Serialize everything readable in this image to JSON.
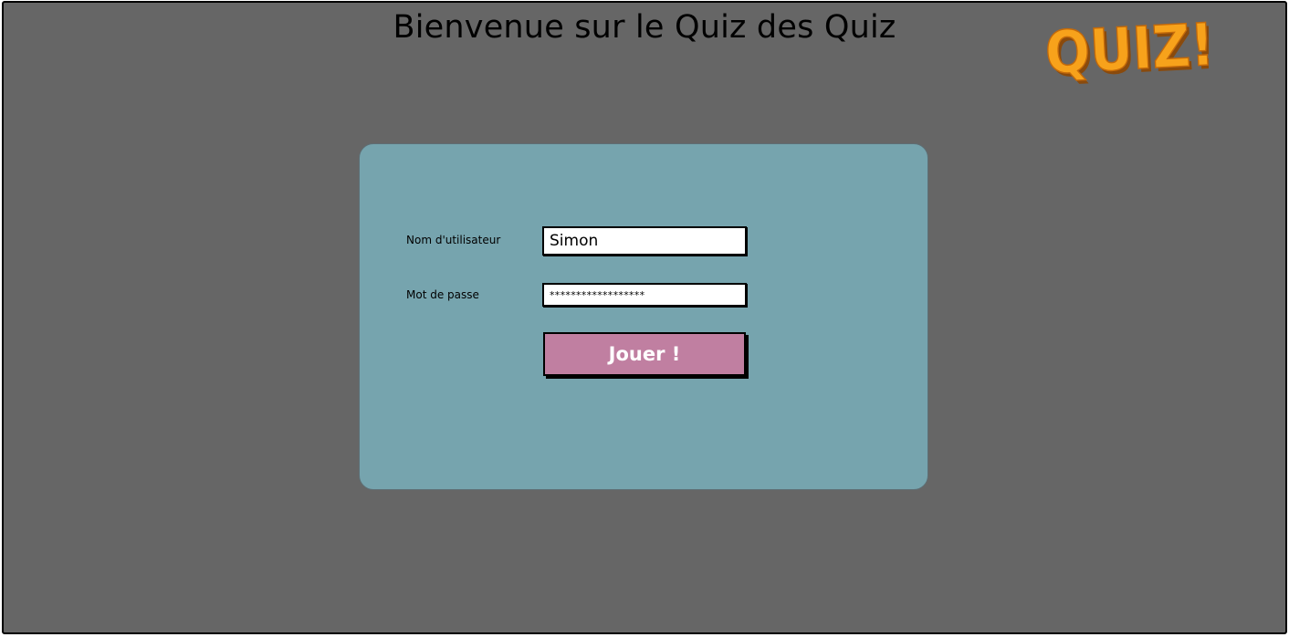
{
  "header": {
    "title": "Bienvenue sur le Quiz des Quiz",
    "logo_text": "QUIZ!",
    "logo_color": "#f7a21b"
  },
  "login_form": {
    "username_label": "Nom d'utilisateur",
    "username_value": "Simon",
    "password_label": "Mot de passe",
    "password_value": "******************",
    "submit_label": "Jouer !"
  },
  "colors": {
    "background": "#666666",
    "panel": "#76a4ae",
    "button": "#c07fa1"
  }
}
